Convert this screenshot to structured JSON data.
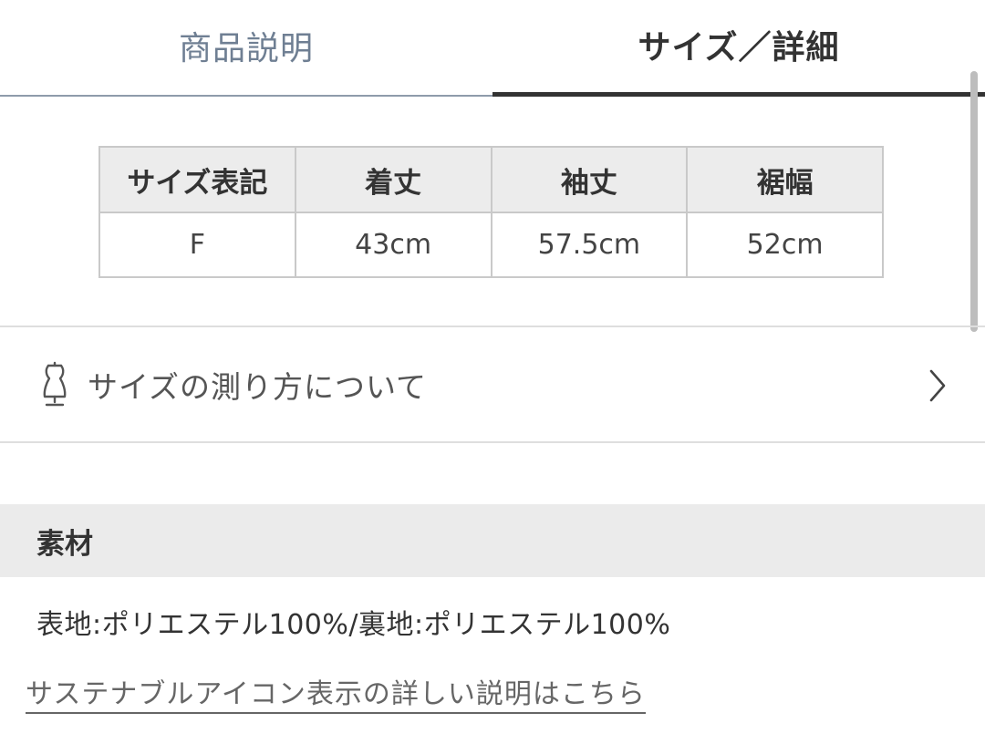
{
  "tabs": {
    "left_label": "商品説明",
    "right_label": "サイズ／詳細"
  },
  "size_table": {
    "headers": [
      "サイズ表記",
      "着丈",
      "袖丈",
      "裾幅"
    ],
    "rows": [
      [
        "F",
        "43cm",
        "57.5cm",
        "52cm"
      ]
    ]
  },
  "measure": {
    "icon": "dress-form-icon",
    "label": "サイズの測り方について",
    "chevron": "chevron-right-icon"
  },
  "material": {
    "header": "素材",
    "text": "表地:ポリエステル100%/裏地:ポリエステル100%"
  },
  "sustain_link": "サステナブルアイコン表示の詳しい説明はこちら",
  "colors": {
    "active_tab": "#333333",
    "inactive_tab": "#6f7f93",
    "header_bg": "#ececec"
  }
}
